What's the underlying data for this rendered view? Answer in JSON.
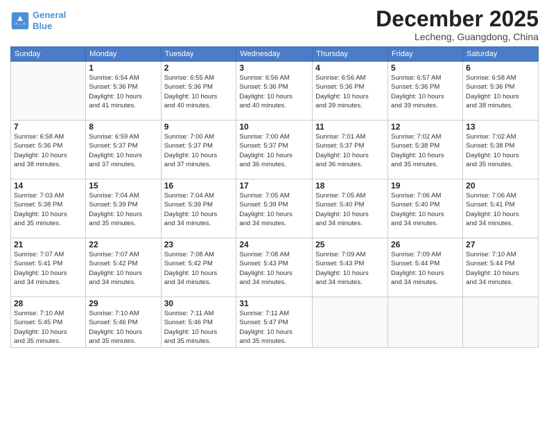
{
  "logo": {
    "line1": "General",
    "line2": "Blue"
  },
  "title": "December 2025",
  "location": "Lecheng, Guangdong, China",
  "days_of_week": [
    "Sunday",
    "Monday",
    "Tuesday",
    "Wednesday",
    "Thursday",
    "Friday",
    "Saturday"
  ],
  "weeks": [
    [
      {
        "day": null
      },
      {
        "day": 1,
        "sunrise": "6:54 AM",
        "sunset": "5:36 PM",
        "daylight": "10 hours and 41 minutes."
      },
      {
        "day": 2,
        "sunrise": "6:55 AM",
        "sunset": "5:36 PM",
        "daylight": "10 hours and 40 minutes."
      },
      {
        "day": 3,
        "sunrise": "6:56 AM",
        "sunset": "5:36 PM",
        "daylight": "10 hours and 40 minutes."
      },
      {
        "day": 4,
        "sunrise": "6:56 AM",
        "sunset": "5:36 PM",
        "daylight": "10 hours and 39 minutes."
      },
      {
        "day": 5,
        "sunrise": "6:57 AM",
        "sunset": "5:36 PM",
        "daylight": "10 hours and 39 minutes."
      },
      {
        "day": 6,
        "sunrise": "6:58 AM",
        "sunset": "5:36 PM",
        "daylight": "10 hours and 38 minutes."
      }
    ],
    [
      {
        "day": 7,
        "sunrise": "6:58 AM",
        "sunset": "5:36 PM",
        "daylight": "10 hours and 38 minutes."
      },
      {
        "day": 8,
        "sunrise": "6:59 AM",
        "sunset": "5:37 PM",
        "daylight": "10 hours and 37 minutes."
      },
      {
        "day": 9,
        "sunrise": "7:00 AM",
        "sunset": "5:37 PM",
        "daylight": "10 hours and 37 minutes."
      },
      {
        "day": 10,
        "sunrise": "7:00 AM",
        "sunset": "5:37 PM",
        "daylight": "10 hours and 36 minutes."
      },
      {
        "day": 11,
        "sunrise": "7:01 AM",
        "sunset": "5:37 PM",
        "daylight": "10 hours and 36 minutes."
      },
      {
        "day": 12,
        "sunrise": "7:02 AM",
        "sunset": "5:38 PM",
        "daylight": "10 hours and 35 minutes."
      },
      {
        "day": 13,
        "sunrise": "7:02 AM",
        "sunset": "5:38 PM",
        "daylight": "10 hours and 35 minutes."
      }
    ],
    [
      {
        "day": 14,
        "sunrise": "7:03 AM",
        "sunset": "5:38 PM",
        "daylight": "10 hours and 35 minutes."
      },
      {
        "day": 15,
        "sunrise": "7:04 AM",
        "sunset": "5:39 PM",
        "daylight": "10 hours and 35 minutes."
      },
      {
        "day": 16,
        "sunrise": "7:04 AM",
        "sunset": "5:39 PM",
        "daylight": "10 hours and 34 minutes."
      },
      {
        "day": 17,
        "sunrise": "7:05 AM",
        "sunset": "5:39 PM",
        "daylight": "10 hours and 34 minutes."
      },
      {
        "day": 18,
        "sunrise": "7:05 AM",
        "sunset": "5:40 PM",
        "daylight": "10 hours and 34 minutes."
      },
      {
        "day": 19,
        "sunrise": "7:06 AM",
        "sunset": "5:40 PM",
        "daylight": "10 hours and 34 minutes."
      },
      {
        "day": 20,
        "sunrise": "7:06 AM",
        "sunset": "5:41 PM",
        "daylight": "10 hours and 34 minutes."
      }
    ],
    [
      {
        "day": 21,
        "sunrise": "7:07 AM",
        "sunset": "5:41 PM",
        "daylight": "10 hours and 34 minutes."
      },
      {
        "day": 22,
        "sunrise": "7:07 AM",
        "sunset": "5:42 PM",
        "daylight": "10 hours and 34 minutes."
      },
      {
        "day": 23,
        "sunrise": "7:08 AM",
        "sunset": "5:42 PM",
        "daylight": "10 hours and 34 minutes."
      },
      {
        "day": 24,
        "sunrise": "7:08 AM",
        "sunset": "5:43 PM",
        "daylight": "10 hours and 34 minutes."
      },
      {
        "day": 25,
        "sunrise": "7:09 AM",
        "sunset": "5:43 PM",
        "daylight": "10 hours and 34 minutes."
      },
      {
        "day": 26,
        "sunrise": "7:09 AM",
        "sunset": "5:44 PM",
        "daylight": "10 hours and 34 minutes."
      },
      {
        "day": 27,
        "sunrise": "7:10 AM",
        "sunset": "5:44 PM",
        "daylight": "10 hours and 34 minutes."
      }
    ],
    [
      {
        "day": 28,
        "sunrise": "7:10 AM",
        "sunset": "5:45 PM",
        "daylight": "10 hours and 35 minutes."
      },
      {
        "day": 29,
        "sunrise": "7:10 AM",
        "sunset": "5:46 PM",
        "daylight": "10 hours and 35 minutes."
      },
      {
        "day": 30,
        "sunrise": "7:11 AM",
        "sunset": "5:46 PM",
        "daylight": "10 hours and 35 minutes."
      },
      {
        "day": 31,
        "sunrise": "7:11 AM",
        "sunset": "5:47 PM",
        "daylight": "10 hours and 35 minutes."
      },
      {
        "day": null
      },
      {
        "day": null
      },
      {
        "day": null
      }
    ]
  ]
}
